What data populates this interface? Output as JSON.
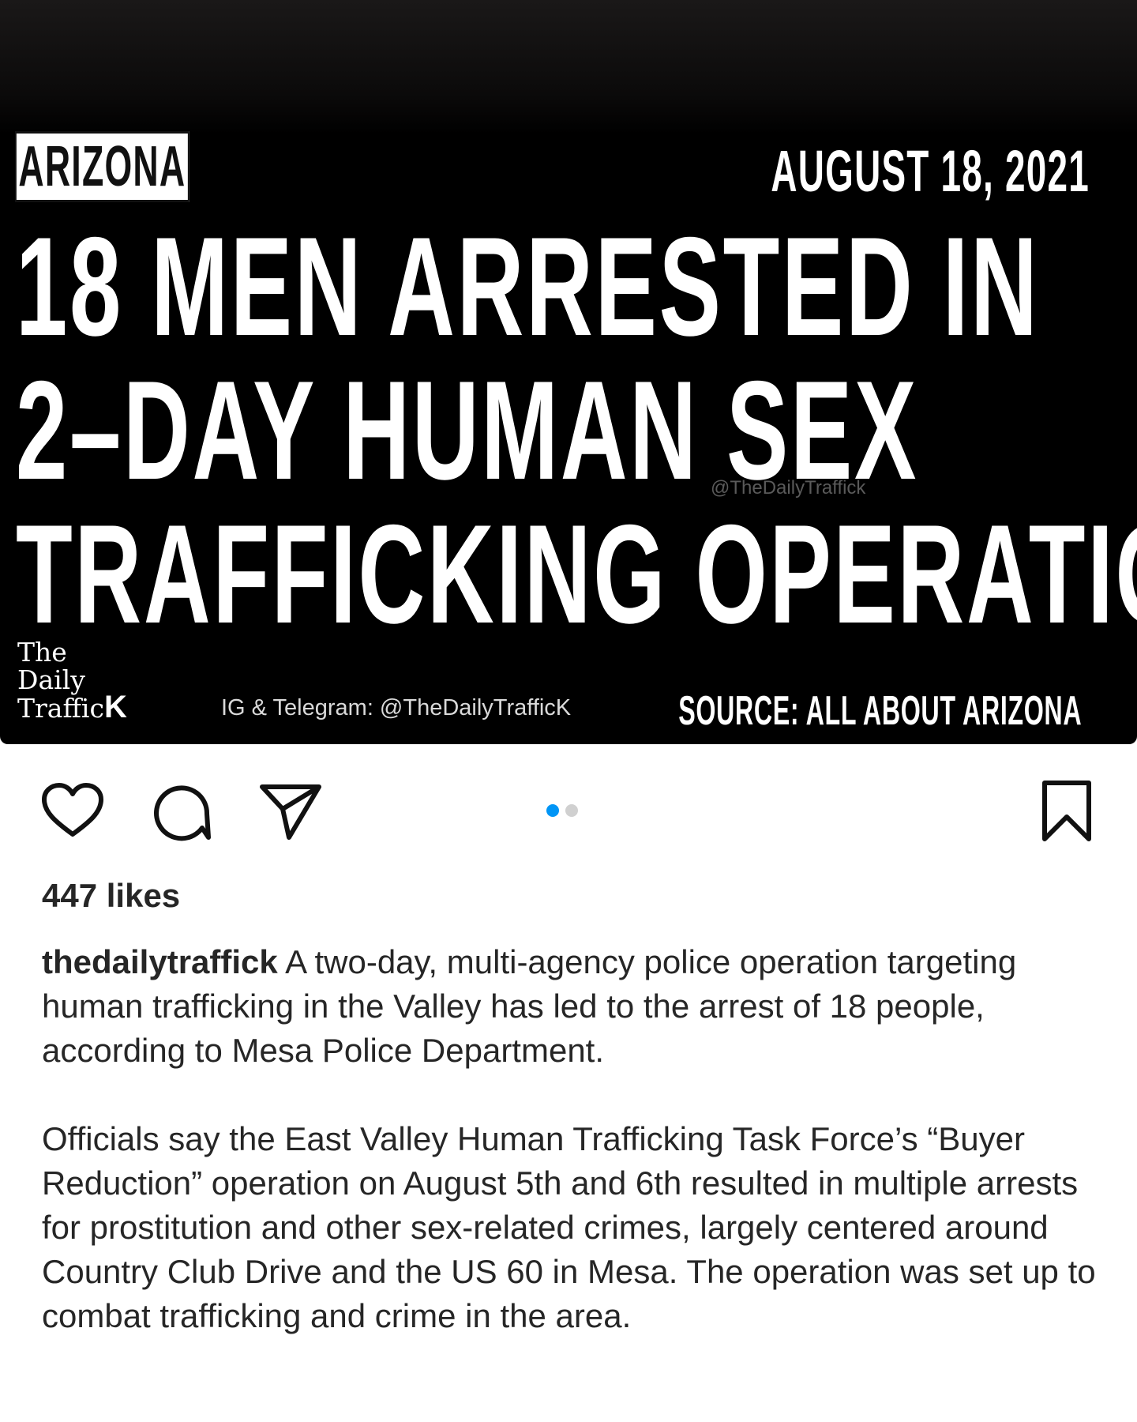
{
  "post_image": {
    "region": "ARIZONA",
    "date": "AUGUST 18, 2021",
    "headline_lines": [
      "18 MEN ARRESTED IN",
      "2–DAY HUMAN SEX",
      "TRAFFICKING OPERATION"
    ],
    "watermark": "@TheDailyTraffick",
    "brand_lines": [
      "The",
      "Daily",
      "Traffic"
    ],
    "brand_k": "K",
    "social": "IG & Telegram: @TheDailyTrafficK",
    "source": "SOURCE: ALL ABOUT ARIZONA"
  },
  "actions": {
    "icons": [
      "heart-icon",
      "comment-icon",
      "share-icon",
      "bookmark-icon"
    ],
    "carousel": {
      "count": 2,
      "active": 1,
      "active_color": "#0095f6",
      "inactive_color": "#d0d0d0"
    }
  },
  "likes": "447 likes",
  "caption": {
    "username": "thedailytraffick",
    "paragraph_1": " A two-day, multi-agency police operation targeting human trafficking in the Valley has led to the arrest of 18 people, according to Mesa Police Department.",
    "paragraph_2": "Officials say the East Valley Human Trafficking Task Force’s “Buyer Reduction” operation on August 5th and 6th resulted in multiple arrests for prostitution and other sex-related crimes, largely centered around Country Club Drive and the US 60 in Mesa. The operation was set up to combat trafficking and crime in the area."
  }
}
